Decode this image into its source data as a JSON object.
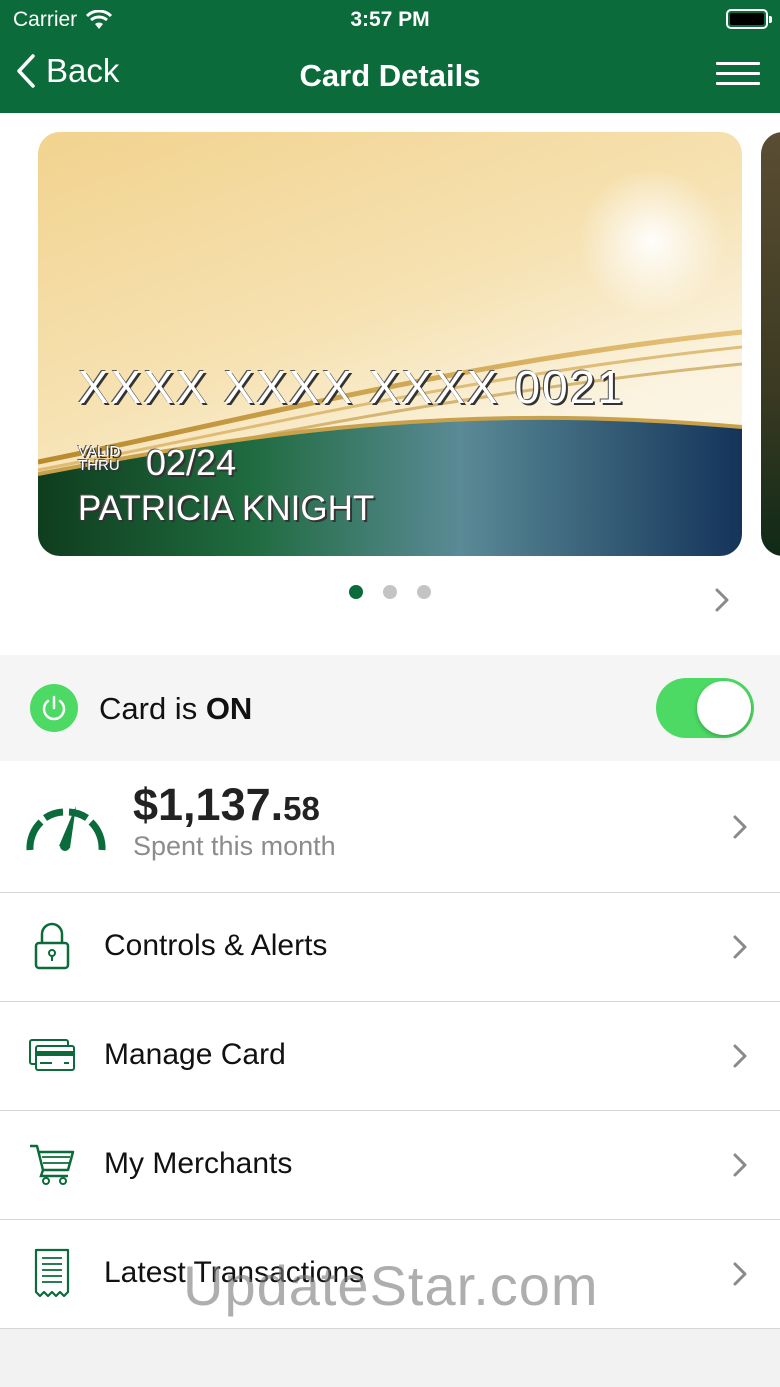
{
  "status_bar": {
    "carrier": "Carrier",
    "time": "3:57 PM"
  },
  "nav": {
    "back_label": "Back",
    "title": "Card Details"
  },
  "card": {
    "number": "XXXX XXXX XXXX 0021",
    "valid_line1": "VALID",
    "valid_line2": "THRU",
    "expiry": "02/24",
    "holder": "PATRICIA KNIGHT"
  },
  "carousel": {
    "page_count": 3,
    "active_page": 1
  },
  "card_status": {
    "prefix": "Card is ",
    "state": "ON",
    "toggle_on": true
  },
  "spending": {
    "amount_main": "$1,137.",
    "amount_cents": "58",
    "subtitle": "Spent this month"
  },
  "menu_items": [
    {
      "label": "Controls & Alerts",
      "icon": "lock-icon"
    },
    {
      "label": "Manage Card",
      "icon": "credit-card-icon"
    },
    {
      "label": "My Merchants",
      "icon": "shopping-cart-icon"
    },
    {
      "label": "Latest Transactions",
      "icon": "receipt-icon"
    }
  ],
  "watermark": "UpdateStar.com",
  "colors": {
    "brand_green": "#0b6b3a",
    "toggle_green": "#4cd964",
    "background": "#f2f2f2"
  }
}
